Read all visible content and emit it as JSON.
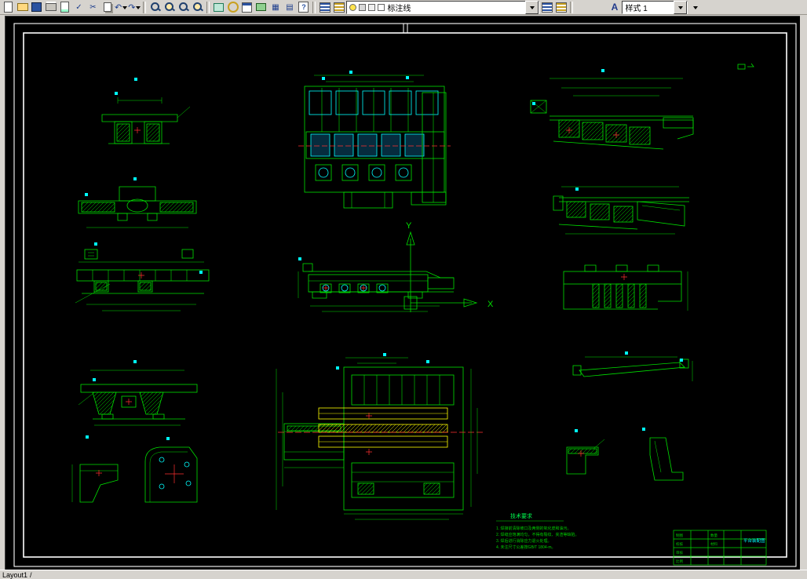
{
  "toolbar": {
    "layer_combo": {
      "value": "标注线"
    },
    "style_combo": {
      "icon": "A",
      "value": "样式 1"
    }
  },
  "ucs": {
    "x_label": "X",
    "y_label": "Y"
  },
  "notes": {
    "title": "技术要求",
    "lines": [
      "1. 焊接前清除坡口及两侧的氧化皮和油污。",
      "2. 焊缝应饱满均匀，不得有裂纹、夹渣等缺陷。",
      "3. 焊后进行消除应力退火处理。",
      "4. 未注尺寸公差按GB/T 1804-m。"
    ]
  },
  "title_block": {
    "name": "平台装配图",
    "cells": [
      "制图",
      "校核",
      "审核",
      "比例",
      "数量",
      "材料"
    ]
  },
  "status_bar": {
    "tab": "Layout1",
    "divider": "/"
  },
  "colors": {
    "line_green": "#00e000",
    "grip_cyan": "#00ffff",
    "center_red": "#ff3030",
    "weld_yellow": "#ffff00",
    "frame_white": "#ffffff",
    "ui_gray": "#d6d3ce"
  }
}
